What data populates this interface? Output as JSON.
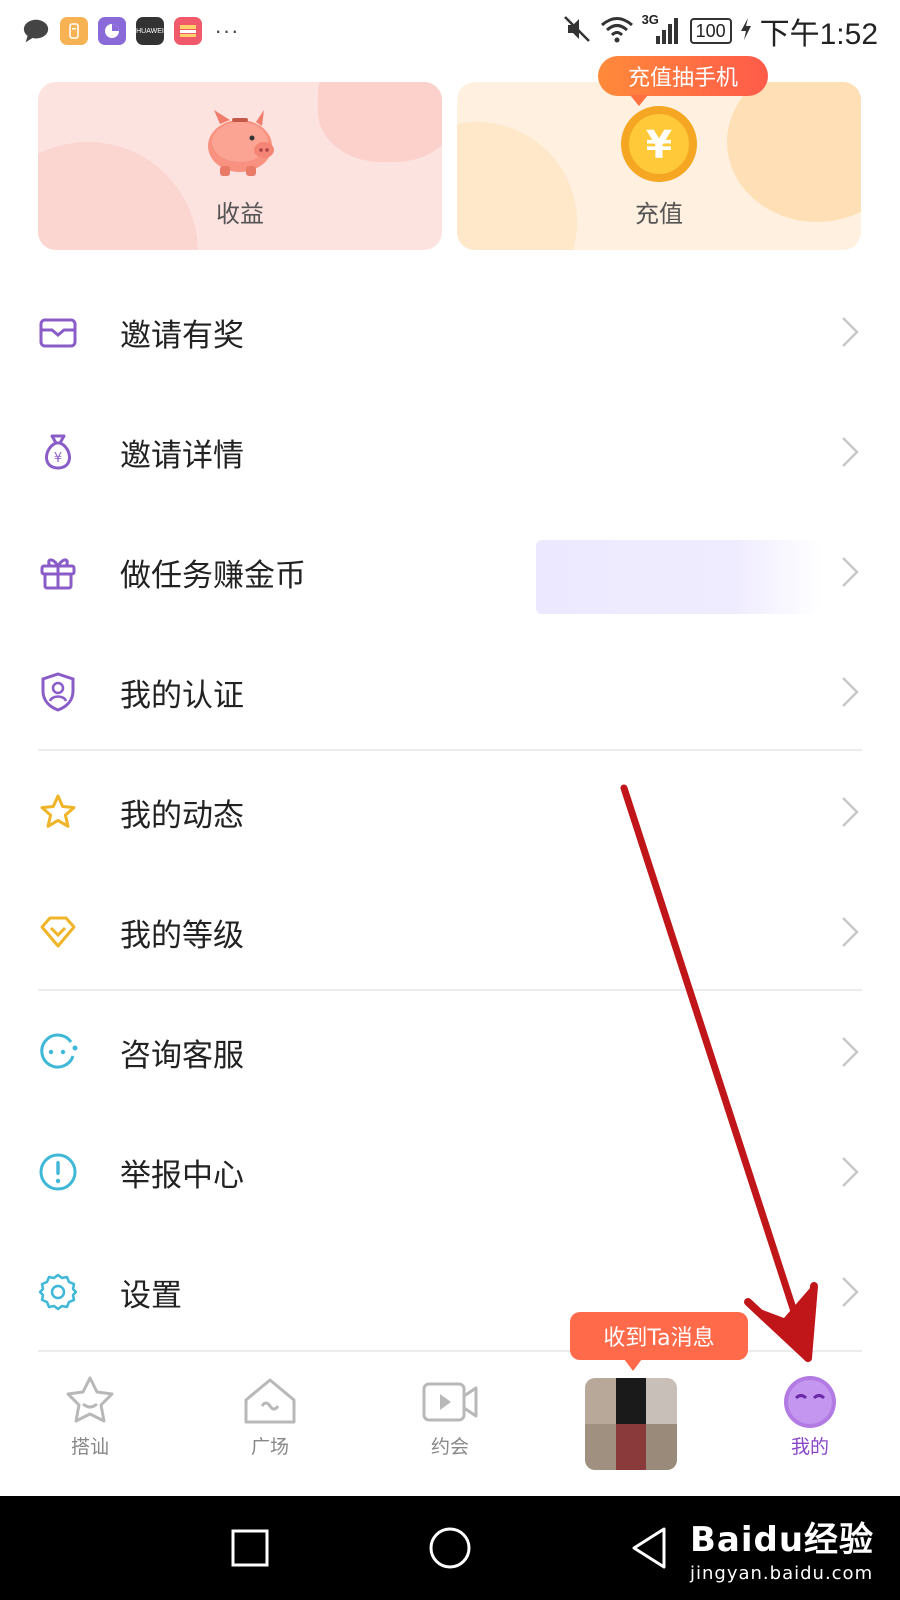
{
  "status_bar": {
    "battery": "100",
    "network": "3G",
    "time": "下午1:52",
    "notification_icons": [
      "chat-icon",
      "file-icon",
      "chart-app-icon",
      "huawei-icon",
      "huawei-app-icon",
      "more-dots"
    ],
    "huawei_text": "HUAWEI",
    "more": "···"
  },
  "cards": {
    "earnings": {
      "label": "收益",
      "icon": "piggy-bank"
    },
    "recharge": {
      "label": "充值",
      "icon": "yuan-coin",
      "promo": "充值抽手机"
    }
  },
  "menu": [
    {
      "label": "邀请有奖",
      "icon": "envelope-icon"
    },
    {
      "label": "邀请详情",
      "icon": "money-bag-icon"
    },
    {
      "label": "做任务赚金币",
      "icon": "gift-icon"
    },
    {
      "label": "我的认证",
      "icon": "shield-user-icon"
    },
    {
      "label": "我的动态",
      "icon": "star-icon"
    },
    {
      "label": "我的等级",
      "icon": "diamond-icon"
    },
    {
      "label": "咨询客服",
      "icon": "chat-support-icon"
    },
    {
      "label": "举报中心",
      "icon": "alert-icon"
    },
    {
      "label": "设置",
      "icon": "settings-icon"
    }
  ],
  "tabs": [
    {
      "label": "搭讪",
      "icon": "star-face-icon"
    },
    {
      "label": "广场",
      "icon": "house-icon"
    },
    {
      "label": "约会",
      "icon": "video-icon"
    },
    {
      "label": "",
      "icon": "message-avatar"
    },
    {
      "label": "我的",
      "icon": "profile-face-icon",
      "active": true
    }
  ],
  "message_notice": "收到Ta消息",
  "colors": {
    "accent_purple": "#8a45c8",
    "icon_purple": "#8a5cc8",
    "icon_gold": "#f0b429",
    "icon_cyan": "#3fb8d8",
    "promo_orange": "#ff6a4a",
    "annotation_red": "#c0161a"
  },
  "watermark": {
    "logo": "Baidu经验",
    "url": "jingyan.baidu.com"
  }
}
